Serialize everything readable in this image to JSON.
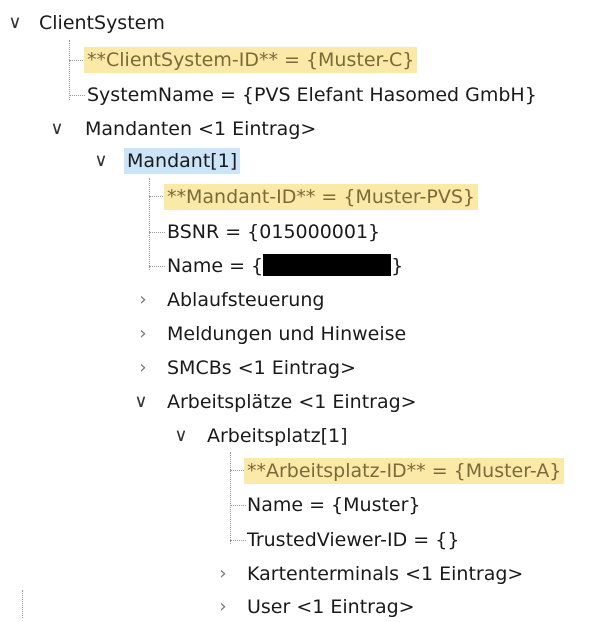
{
  "tree": {
    "client_system": "ClientSystem",
    "client_system_id": "**ClientSystem-ID** = {Muster-C}",
    "system_name": "SystemName = {PVS Elefant Hasomed GmbH}",
    "mandanten": "Mandanten <1 Eintrag>",
    "mandant": "Mandant[1]",
    "mandant_id": "**Mandant-ID** = {Muster-PVS}",
    "bsnr": "BSNR = {015000001}",
    "name_prefix": "Name = {",
    "name_suffix": "}",
    "ablaufsteuerung": "Ablaufsteuerung",
    "meldungen": "Meldungen und Hinweise",
    "smcbs": "SMCBs <1 Eintrag>",
    "arbeitsplaetze": "Arbeitsplätze <1 Eintrag>",
    "arbeitsplatz": "Arbeitsplatz[1]",
    "arbeitsplatz_id": "**Arbeitsplatz-ID** = {Muster-A}",
    "ap_name": "Name = {Muster}",
    "trusted_viewer": "TrustedViewer-ID = {}",
    "kartenterminals": "Kartenterminals <1 Eintrag>",
    "user": "User <1 Eintrag>"
  },
  "colors": {
    "highlight": "#fbe9a8",
    "selected": "#cce4f7"
  },
  "icons": {
    "expanded": "chevron-down-icon",
    "collapsed": "chevron-right-icon"
  }
}
